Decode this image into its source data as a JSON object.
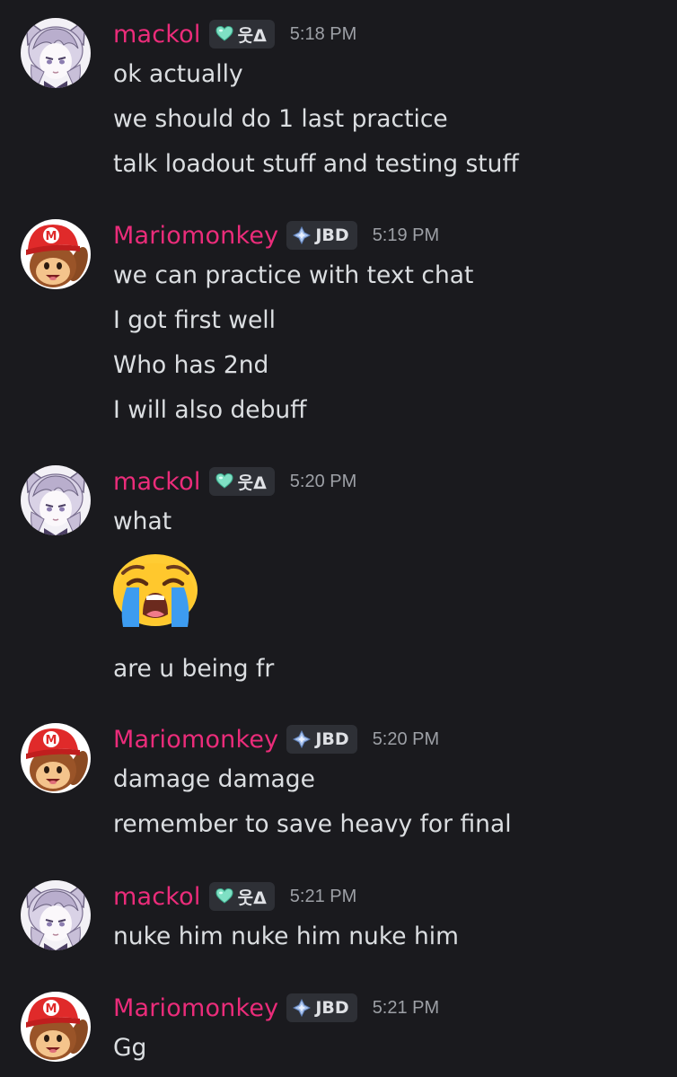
{
  "colors": {
    "background": "#1a1a1e",
    "message_text": "#dbdee1",
    "timestamp": "#9da0a6",
    "tag_background": "#2e3036",
    "username": "#eb2c7a"
  },
  "messages": [
    {
      "username": "mackol",
      "avatar_icon": "anime-cat-girl-avatar",
      "tag_icon": "teal-heart-icon",
      "tag_label": "웃Δ",
      "time": "5:18 PM",
      "lines": [
        "ok actually",
        "we should do 1 last practice",
        "talk loadout stuff and testing stuff"
      ]
    },
    {
      "username": "Mariomonkey",
      "avatar_icon": "monkey-mario-cap-avatar",
      "tag_icon": "diamond-sparkle-icon",
      "tag_label": "JBD",
      "time": "5:19 PM",
      "lines": [
        "we can practice with text chat",
        "I got first well",
        "Who has 2nd",
        "I will also debuff"
      ]
    },
    {
      "username": "mackol",
      "avatar_icon": "anime-cat-girl-avatar",
      "tag_icon": "teal-heart-icon",
      "tag_label": "웃Δ",
      "time": "5:20 PM",
      "lines": [
        "what",
        "are u being fr"
      ],
      "emoji": "loudly-crying-face-emoji"
    },
    {
      "username": "Mariomonkey",
      "avatar_icon": "monkey-mario-cap-avatar",
      "tag_icon": "diamond-sparkle-icon",
      "tag_label": "JBD",
      "time": "5:20 PM",
      "lines": [
        "damage damage",
        "remember to save heavy for final"
      ]
    },
    {
      "username": "mackol",
      "avatar_icon": "anime-cat-girl-avatar",
      "tag_icon": "teal-heart-icon",
      "tag_label": "웃Δ",
      "time": "5:21 PM",
      "lines": [
        "nuke him nuke him nuke him"
      ]
    },
    {
      "username": "Mariomonkey",
      "avatar_icon": "monkey-mario-cap-avatar",
      "tag_icon": "diamond-sparkle-icon",
      "tag_label": "JBD",
      "time": "5:21 PM",
      "lines": [
        "Gg"
      ]
    }
  ]
}
